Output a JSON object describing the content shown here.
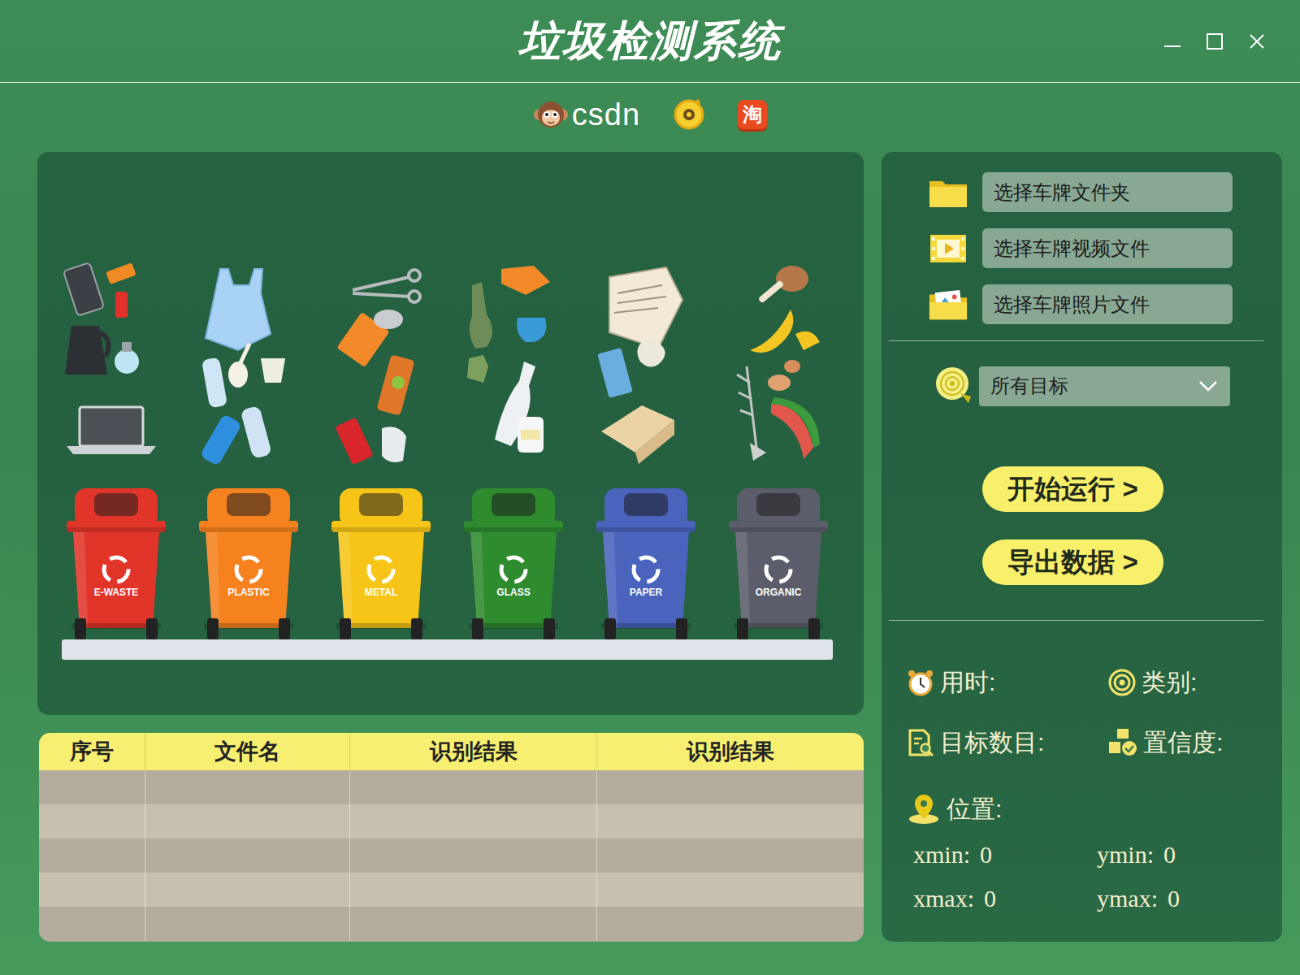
{
  "window": {
    "title": "垃圾检测系统"
  },
  "logos": {
    "csdn": "csdn",
    "taobao": "淘"
  },
  "bins": [
    {
      "label": "E-WASTE",
      "color": "#e2352a"
    },
    {
      "label": "PLASTIC",
      "color": "#f5821f"
    },
    {
      "label": "METAL",
      "color": "#f6c518"
    },
    {
      "label": "GLASS",
      "color": "#2e8b2e"
    },
    {
      "label": "PAPER",
      "color": "#4a63bd"
    },
    {
      "label": "ORGANIC",
      "color": "#5b5e6a"
    }
  ],
  "table": {
    "columns": [
      "序号",
      "文件名",
      "识别结果",
      "识别结果"
    ],
    "rows": [
      [
        "",
        "",
        "",
        ""
      ],
      [
        "",
        "",
        "",
        ""
      ],
      [
        "",
        "",
        "",
        ""
      ],
      [
        "",
        "",
        "",
        ""
      ],
      [
        "",
        "",
        "",
        ""
      ]
    ]
  },
  "file_buttons": [
    {
      "label": "选择车牌文件夹",
      "kind": "folder"
    },
    {
      "label": "选择车牌视频文件",
      "kind": "video"
    },
    {
      "label": "选择车牌照片文件",
      "kind": "photo"
    }
  ],
  "target_select": {
    "value": "所有目标"
  },
  "actions": [
    {
      "label": "开始运行 >"
    },
    {
      "label": "导出数据 >"
    }
  ],
  "info": [
    {
      "label": "用时:",
      "kind": "clock"
    },
    {
      "label": "类别:",
      "kind": "target"
    },
    {
      "label": "目标数目:",
      "kind": "doc"
    },
    {
      "label": "置信度:",
      "kind": "check"
    }
  ],
  "position": {
    "label": "位置:"
  },
  "coords": [
    {
      "label": "xmin:",
      "value": "0"
    },
    {
      "label": "ymin:",
      "value": "0"
    },
    {
      "label": "xmax:",
      "value": "0"
    },
    {
      "label": "ymax:",
      "value": "0"
    }
  ]
}
